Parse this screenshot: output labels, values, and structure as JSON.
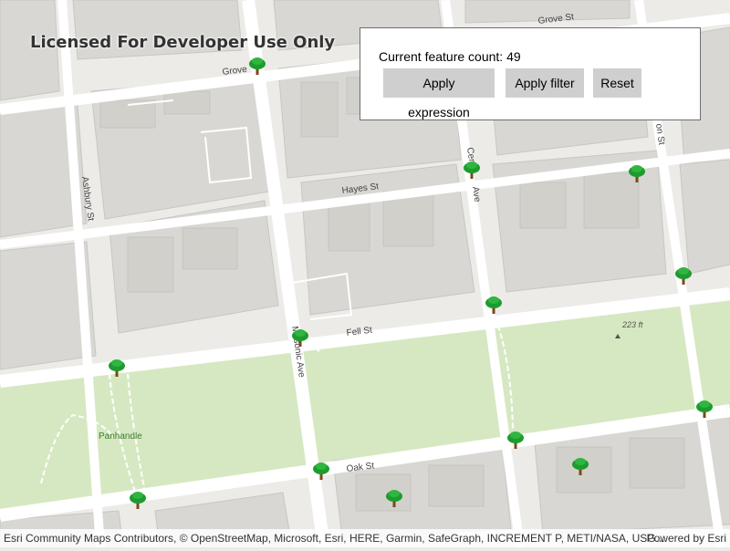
{
  "watermark": "Licensed For Developer Use Only",
  "panel": {
    "count_label": "Current feature count: 49",
    "apply_expression": "Apply expression",
    "apply_filter": "Apply filter",
    "reset": "Reset"
  },
  "map": {
    "streets": [
      "Grove St",
      "Grove",
      "Hayes St",
      "Fell St",
      "Oak St",
      "Ashbury St",
      "Central Ave",
      "Masonic Ave",
      "Lyon St"
    ],
    "street_labels_shown": {
      "grove_right": "Grove St",
      "grove_left": "Grove",
      "hayes": "Hayes St",
      "fell": "Fell St",
      "oak": "Oak St",
      "ashbury": "Ashbury St",
      "central": "Cen",
      "central2": "Ave",
      "masonic": "Masonic Ave",
      "lyon": "on St"
    },
    "park_label": "Panhandle",
    "elevation_label": "223 ft",
    "colors": {
      "park": "#d6e8c2",
      "road": "#ffffff",
      "building": "#d9d7d3",
      "tree_canopy": "#1e9b2f",
      "tree_trunk": "#7a4a1c"
    }
  },
  "attribution": {
    "text": "Esri Community Maps Contributors, © OpenStreetMap, Microsoft, Esri, HERE, Garmin, SafeGraph, INCREMENT P, METI/NASA, USG...",
    "powered_by": "Powered by Esri"
  }
}
